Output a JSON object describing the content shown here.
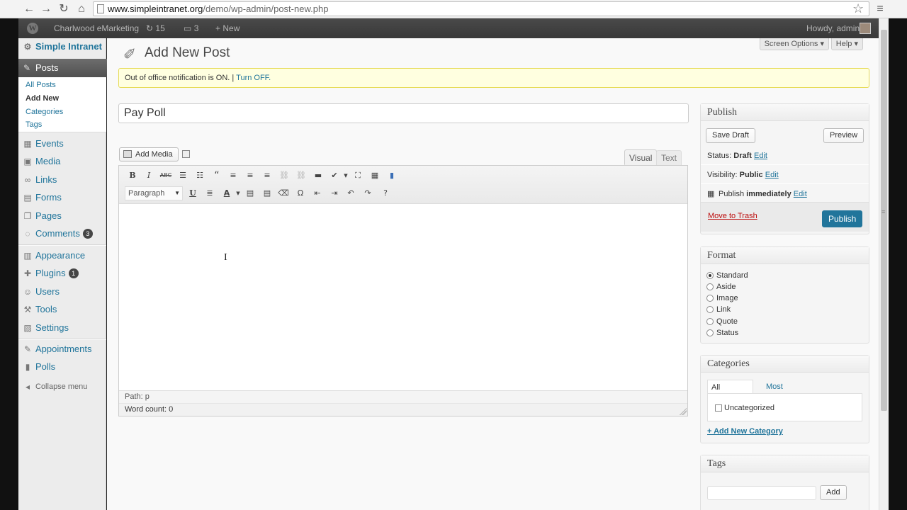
{
  "browser": {
    "url_host": "www.simpleintranet.org",
    "url_path": "/demo/wp-admin/post-new.php"
  },
  "admin_bar": {
    "site_name": "Charlwood eMarketing",
    "updates_count": "15",
    "comments_count": "3",
    "new_label": "New",
    "howdy": "Howdy, admin"
  },
  "sidebar": {
    "site_item": "Simple Intranet",
    "posts_label": "Posts",
    "posts_sub": [
      "All Posts",
      "Add New",
      "Categories",
      "Tags"
    ],
    "items": [
      {
        "label": "Events",
        "icon": "calendar-icon"
      },
      {
        "label": "Media",
        "icon": "media-icon"
      },
      {
        "label": "Links",
        "icon": "link-icon"
      },
      {
        "label": "Forms",
        "icon": "forms-icon"
      },
      {
        "label": "Pages",
        "icon": "pages-icon"
      },
      {
        "label": "Comments",
        "icon": "comments-icon",
        "badge": "3"
      },
      {
        "label": "Appearance",
        "icon": "appearance-icon"
      },
      {
        "label": "Plugins",
        "icon": "plugins-icon",
        "badge": "1"
      },
      {
        "label": "Users",
        "icon": "users-icon"
      },
      {
        "label": "Tools",
        "icon": "tools-icon"
      },
      {
        "label": "Settings",
        "icon": "settings-icon"
      },
      {
        "label": "Appointments",
        "icon": "appointments-icon"
      },
      {
        "label": "Polls",
        "icon": "polls-icon"
      }
    ],
    "collapse_label": "Collapse menu"
  },
  "header": {
    "screen_options": "Screen Options ▾",
    "help": "Help ▾",
    "title": "Add New Post"
  },
  "notice": {
    "text": "Out of office notification is ON. | ",
    "link": "Turn OFF."
  },
  "post": {
    "title_value": "Pay Poll"
  },
  "editor": {
    "add_media": "Add Media",
    "tab_visual": "Visual",
    "tab_text": "Text",
    "format_value": "Paragraph",
    "path": "Path: p",
    "word_count": "Word count: 0"
  },
  "publish_box": {
    "title": "Publish",
    "save_draft": "Save Draft",
    "preview": "Preview",
    "status_label": "Status: ",
    "status_value": "Draft",
    "visibility_label": "Visibility: ",
    "visibility_value": "Public",
    "publish_label": "Publish ",
    "publish_value": "immediately",
    "edit": "Edit",
    "move_to_trash": "Move to Trash",
    "publish_button": "Publish"
  },
  "format_box": {
    "title": "Format",
    "options": [
      "Standard",
      "Aside",
      "Image",
      "Link",
      "Quote",
      "Status"
    ],
    "selected": "Standard"
  },
  "categories_box": {
    "title": "Categories",
    "tab_all": "All Categories",
    "tab_most_used": "Most Used",
    "items": [
      "Uncategorized"
    ],
    "add_new": "+ Add New Category"
  },
  "tags_box": {
    "title": "Tags",
    "add_button": "Add"
  },
  "colors": {
    "link": "#21759b",
    "trash": "#bc0b0b",
    "notice_bg": "#ffffe0"
  }
}
